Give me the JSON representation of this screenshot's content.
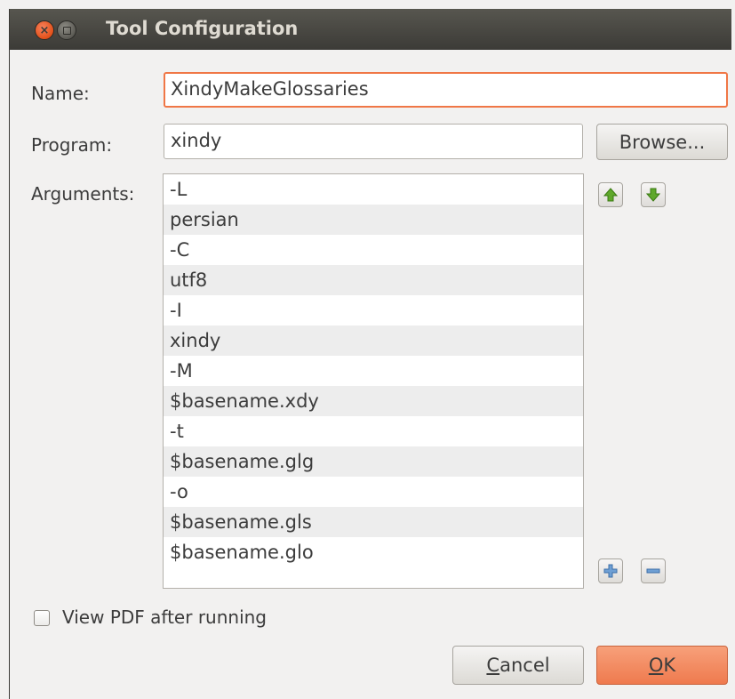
{
  "window": {
    "title": "Tool Configuration"
  },
  "titlebar_icons": [
    "close-icon",
    "maximize-icon"
  ],
  "name": {
    "label": "Name:",
    "value": "XindyMakeGlossaries"
  },
  "program": {
    "label": "Program:",
    "value": "xindy",
    "browse_label": "Browse..."
  },
  "arguments": {
    "label": "Arguments:",
    "items": [
      "-L",
      "persian",
      "-C",
      "utf8",
      "-I",
      "xindy",
      "-M",
      "$basename.xdy",
      "-t",
      "$basename.glg",
      "-o",
      "$basename.gls",
      "$basename.glo"
    ],
    "icons": [
      "move-up-icon",
      "move-down-icon",
      "add-icon",
      "remove-icon"
    ]
  },
  "view_pdf": {
    "label": "View PDF after running",
    "checked": false
  },
  "buttons": {
    "cancel": {
      "mnemonic": "C",
      "rest": "ancel"
    },
    "ok": {
      "mnemonic": "O",
      "rest": "K"
    }
  },
  "colors": {
    "accent": "#f07746",
    "titlebar": "#3c3b37",
    "arrow_green": "#4e9a06"
  }
}
